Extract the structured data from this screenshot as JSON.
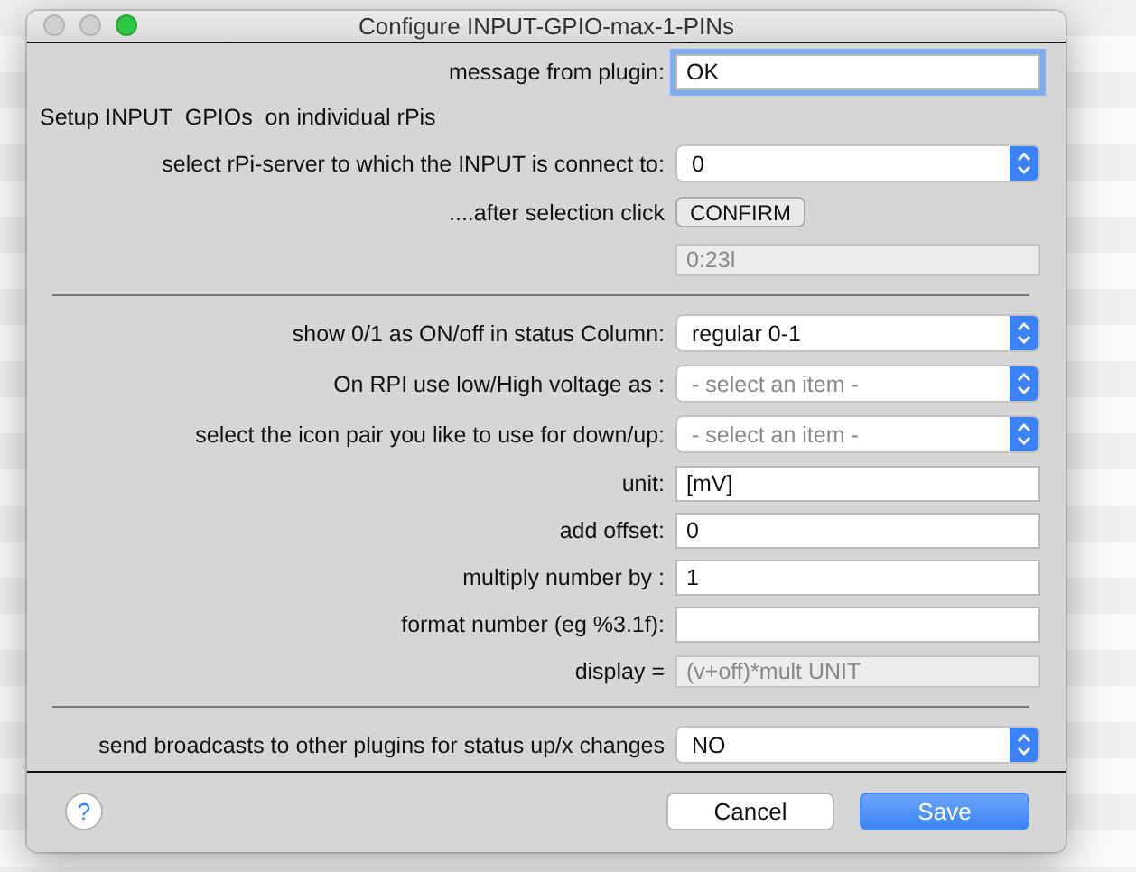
{
  "window": {
    "title": "Configure INPUT-GPIO-max-1-PINs"
  },
  "rows": [
    {
      "kind": "text",
      "label": "message from plugin:",
      "value": "OK",
      "focused": true
    },
    {
      "kind": "note",
      "label": "Setup INPUT  GPIOs  on individual rPis"
    },
    {
      "kind": "select",
      "label": "select rPi-server to which the INPUT is connect to:",
      "value": "0"
    },
    {
      "kind": "button",
      "label": "....after selection click",
      "button": "CONFIRM"
    },
    {
      "kind": "readonly",
      "value": "0:23l"
    },
    {
      "kind": "divider"
    },
    {
      "kind": "select",
      "label": "show 0/1 as ON/off in status Column:",
      "value": "regular 0-1"
    },
    {
      "kind": "select",
      "label": "On RPI use low/High voltage as  :",
      "placeholder": "- select an item -"
    },
    {
      "kind": "select",
      "label": "select the icon pair you like to use for down/up:",
      "placeholder": "- select an item -"
    },
    {
      "kind": "text",
      "label": "unit:",
      "value": "[mV]",
      "focused": false
    },
    {
      "kind": "text",
      "label": "add offset:",
      "value": "0",
      "focused": false
    },
    {
      "kind": "text",
      "label": "multiply number by :",
      "value": "1",
      "focused": false
    },
    {
      "kind": "text",
      "label": "format number (eg %3.1f):",
      "focused": false
    },
    {
      "kind": "readonly",
      "label": "display =",
      "value": "(v+off)*mult UNIT"
    },
    {
      "kind": "divider"
    },
    {
      "kind": "select",
      "label": "send broadcasts to other plugins for status up/x changes",
      "value": "NO"
    }
  ],
  "footer": {
    "help": "?",
    "buttons": [
      {
        "label": "Cancel",
        "default": false
      },
      {
        "label": "Save",
        "default": true
      }
    ]
  }
}
